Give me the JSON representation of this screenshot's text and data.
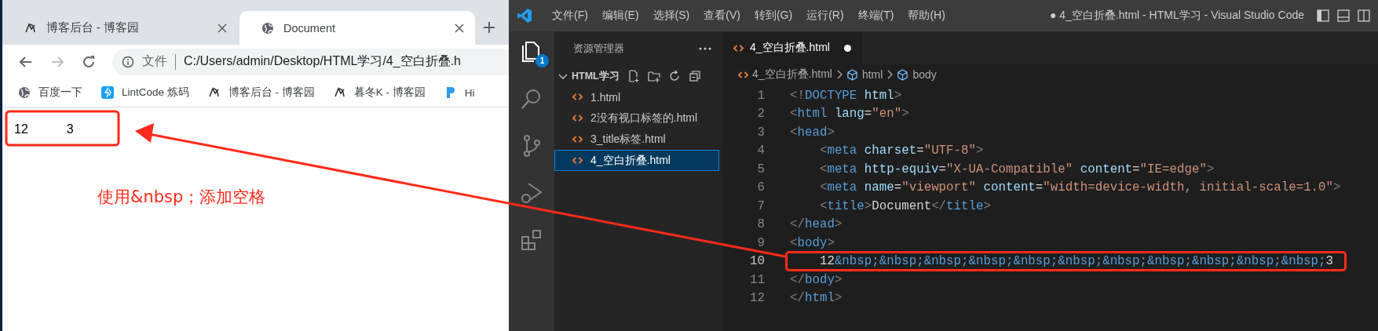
{
  "browser": {
    "tabs": [
      {
        "title": "博客后台 - 博客园",
        "kind": "blog",
        "selected": false
      },
      {
        "title": "Document",
        "kind": "globe",
        "selected": true
      }
    ],
    "nav_buttons": [
      {
        "kind": "back",
        "disabled": false
      },
      {
        "kind": "forward",
        "disabled": true
      },
      {
        "kind": "reload",
        "disabled": false
      }
    ],
    "address": {
      "scheme_label": "文件",
      "url": "C:/Users/admin/Desktop/HTML学习/4_空白折叠.h"
    },
    "bookmarks": [
      {
        "label": "百度一下",
        "kind": "globe"
      },
      {
        "label": "LintCode 炼码",
        "kind": "code"
      },
      {
        "label": "博客后台 - 博客园",
        "kind": "blog"
      },
      {
        "label": "暮冬K - 博客园",
        "kind": "blog"
      },
      {
        "label": "Hi",
        "kind": "letter"
      }
    ],
    "page_text": "12           3",
    "annotation": "使用&nbsp；添加空格"
  },
  "vscode": {
    "title_bar": {
      "menus": [
        "文件(F)",
        "编辑(E)",
        "选择(S)",
        "查看(V)",
        "转到(G)",
        "运行(R)",
        "终端(T)",
        "帮助(H)"
      ],
      "title": "● 4_空白折叠.html - HTML学习 - Visual Studio Code"
    },
    "activity_bar": [
      {
        "kind": "explorer",
        "selected": true,
        "badge": "1"
      },
      {
        "kind": "search",
        "selected": false
      },
      {
        "kind": "source-control",
        "selected": false
      },
      {
        "kind": "run-debug",
        "selected": false
      },
      {
        "kind": "extensions",
        "selected": false
      }
    ],
    "explorer": {
      "title": "资源管理器",
      "folder": {
        "name": "HTML学习",
        "expanded": true,
        "children": [
          {
            "name": "1.html",
            "selected": false
          },
          {
            "name": "2没有视口标签的.html",
            "selected": false
          },
          {
            "name": "3_title标签.html",
            "selected": false
          },
          {
            "name": "4_空白折叠.html",
            "selected": true
          }
        ]
      }
    },
    "editor": {
      "tabs": [
        {
          "name": "4_空白折叠.html",
          "modified": true,
          "selected": true
        }
      ],
      "breadcrumbs": [
        {
          "kind": "file",
          "text": "4_空白折叠.html"
        },
        {
          "kind": "symbol",
          "text": "html"
        },
        {
          "kind": "symbol",
          "text": "body"
        }
      ],
      "lines": [
        {
          "number": "1",
          "active": false,
          "tokens": [
            {
              "kind": "punct",
              "text": "<!"
            },
            {
              "kind": "tag",
              "text": "DOCTYPE"
            },
            {
              "kind": "attr",
              "text": " html"
            },
            {
              "kind": "punct",
              "text": ">"
            }
          ]
        },
        {
          "number": "2",
          "active": false,
          "tokens": [
            {
              "kind": "punct",
              "text": "<"
            },
            {
              "kind": "tag",
              "text": "html"
            },
            {
              "kind": "attr",
              "text": " lang"
            },
            {
              "kind": "text",
              "text": "="
            },
            {
              "kind": "string",
              "text": "\"en\""
            },
            {
              "kind": "punct",
              "text": ">"
            }
          ]
        },
        {
          "number": "3",
          "active": false,
          "tokens": [
            {
              "kind": "punct",
              "text": "<"
            },
            {
              "kind": "tag",
              "text": "head"
            },
            {
              "kind": "punct",
              "text": ">"
            }
          ]
        },
        {
          "number": "4",
          "active": false,
          "tokens": [
            {
              "kind": "punct",
              "text": "    <"
            },
            {
              "kind": "tag",
              "text": "meta"
            },
            {
              "kind": "attr",
              "text": " charset"
            },
            {
              "kind": "text",
              "text": "="
            },
            {
              "kind": "string",
              "text": "\"UTF-8\""
            },
            {
              "kind": "punct",
              "text": ">"
            }
          ]
        },
        {
          "number": "5",
          "active": false,
          "tokens": [
            {
              "kind": "punct",
              "text": "    <"
            },
            {
              "kind": "tag",
              "text": "meta"
            },
            {
              "kind": "attr",
              "text": " http-equiv"
            },
            {
              "kind": "text",
              "text": "="
            },
            {
              "kind": "string",
              "text": "\"X-UA-Compatible\""
            },
            {
              "kind": "attr",
              "text": " content"
            },
            {
              "kind": "text",
              "text": "="
            },
            {
              "kind": "string",
              "text": "\"IE=edge\""
            },
            {
              "kind": "punct",
              "text": ">"
            }
          ]
        },
        {
          "number": "6",
          "active": false,
          "tokens": [
            {
              "kind": "punct",
              "text": "    <"
            },
            {
              "kind": "tag",
              "text": "meta"
            },
            {
              "kind": "attr",
              "text": " name"
            },
            {
              "kind": "text",
              "text": "="
            },
            {
              "kind": "string",
              "text": "\"viewport\""
            },
            {
              "kind": "attr",
              "text": " content"
            },
            {
              "kind": "text",
              "text": "="
            },
            {
              "kind": "string",
              "text": "\"width=device-width, initial-scale=1.0\""
            },
            {
              "kind": "punct",
              "text": ">"
            }
          ]
        },
        {
          "number": "7",
          "active": false,
          "tokens": [
            {
              "kind": "punct",
              "text": "    <"
            },
            {
              "kind": "tag",
              "text": "title"
            },
            {
              "kind": "punct",
              "text": ">"
            },
            {
              "kind": "text",
              "text": "Document"
            },
            {
              "kind": "punct",
              "text": "</"
            },
            {
              "kind": "tag",
              "text": "title"
            },
            {
              "kind": "punct",
              "text": ">"
            }
          ]
        },
        {
          "number": "8",
          "active": false,
          "tokens": [
            {
              "kind": "punct",
              "text": "</"
            },
            {
              "kind": "tag",
              "text": "head"
            },
            {
              "kind": "punct",
              "text": ">"
            }
          ]
        },
        {
          "number": "9",
          "active": false,
          "tokens": [
            {
              "kind": "punct",
              "text": "<"
            },
            {
              "kind": "tag",
              "text": "body"
            },
            {
              "kind": "punct",
              "text": ">"
            }
          ]
        },
        {
          "number": "10",
          "active": true,
          "outlined": true,
          "tokens": [
            {
              "kind": "text",
              "text": "    12"
            },
            {
              "kind": "entity",
              "text": "&nbsp;&nbsp;&nbsp;&nbsp;&nbsp;&nbsp;&nbsp;&nbsp;&nbsp;&nbsp;&nbsp;"
            },
            {
              "kind": "text",
              "text": "3"
            }
          ]
        },
        {
          "number": "11",
          "active": false,
          "tokens": [
            {
              "kind": "punct",
              "text": "</"
            },
            {
              "kind": "tag",
              "text": "body"
            },
            {
              "kind": "punct",
              "text": ">"
            }
          ]
        },
        {
          "number": "12",
          "active": false,
          "tokens": [
            {
              "kind": "punct",
              "text": "</"
            },
            {
              "kind": "tag",
              "text": "html"
            },
            {
              "kind": "punct",
              "text": ">"
            }
          ]
        }
      ]
    }
  }
}
